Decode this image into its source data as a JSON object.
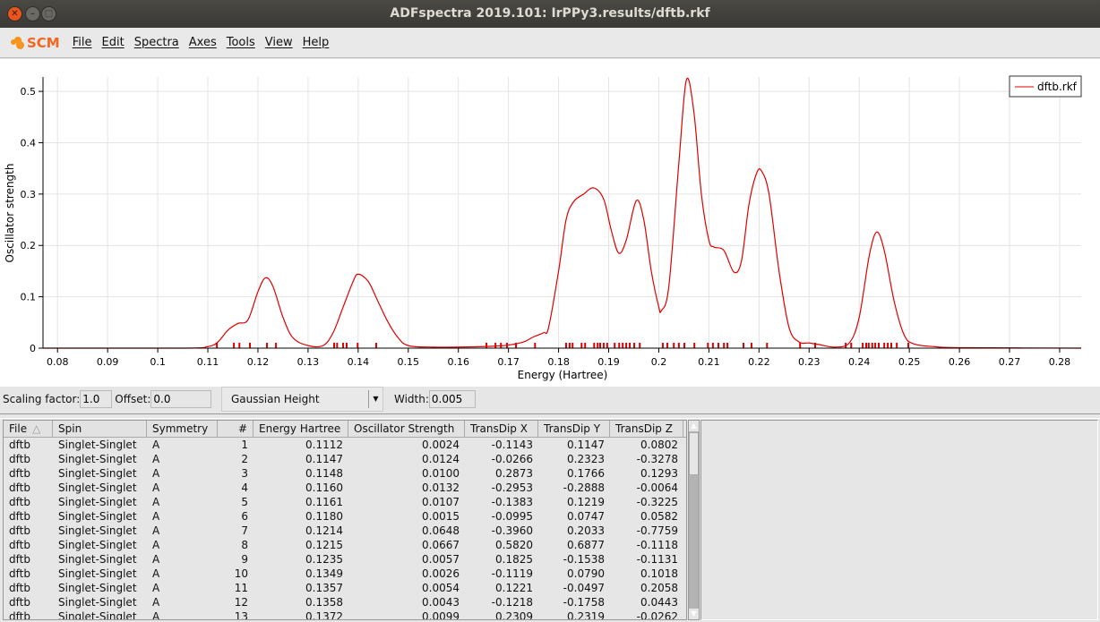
{
  "window": {
    "title": "ADFspectra 2019.101: IrPPy3.results/dftb.rkf"
  },
  "menu": {
    "logo": "SCM",
    "items": [
      "File",
      "Edit",
      "Spectra",
      "Axes",
      "Tools",
      "View",
      "Help"
    ]
  },
  "controls": {
    "scaling_label": "Scaling factor:",
    "scaling_value": "1.0",
    "offset_label": "Offset:",
    "offset_value": "0.0",
    "broadening": "Gaussian Height",
    "width_label": "Width:",
    "width_value": "0.005"
  },
  "chart_data": {
    "type": "line",
    "xlabel": "Energy (Hartree)",
    "ylabel": "Oscillator strength",
    "xlim": [
      0.0771,
      0.2843
    ],
    "ylim": [
      0,
      0.528
    ],
    "xticks": [
      0.08,
      0.09,
      0.1,
      0.11,
      0.12,
      0.13,
      0.14,
      0.15,
      0.16,
      0.17,
      0.18,
      0.19,
      0.2,
      0.21,
      0.22,
      0.23,
      0.24,
      0.25,
      0.26,
      0.27,
      0.28
    ],
    "yticks": [
      0,
      0.1,
      0.2,
      0.3,
      0.4,
      0.5
    ],
    "grid": true,
    "legend_placement": "top-right",
    "color": "#e00000",
    "series": [
      {
        "name": "dftb.rkf",
        "x": [
          0.0771,
          0.105,
          0.11,
          0.112,
          0.114,
          0.116,
          0.118,
          0.12,
          0.1215,
          0.123,
          0.125,
          0.127,
          0.13,
          0.133,
          0.135,
          0.137,
          0.139,
          0.14,
          0.142,
          0.144,
          0.146,
          0.148,
          0.15,
          0.155,
          0.165,
          0.17,
          0.173,
          0.175,
          0.177,
          0.178,
          0.18,
          0.1815,
          0.183,
          0.185,
          0.187,
          0.189,
          0.1905,
          0.192,
          0.1935,
          0.1955,
          0.197,
          0.1985,
          0.2,
          0.2005,
          0.202,
          0.204,
          0.2055,
          0.207,
          0.2085,
          0.21,
          0.211,
          0.213,
          0.215,
          0.2165,
          0.218,
          0.2195,
          0.2205,
          0.222,
          0.224,
          0.226,
          0.228,
          0.23,
          0.232,
          0.235,
          0.238,
          0.24,
          0.242,
          0.2435,
          0.245,
          0.247,
          0.249,
          0.251,
          0.255,
          0.26,
          0.2843
        ],
        "y": [
          0,
          0,
          0.003,
          0.012,
          0.035,
          0.048,
          0.055,
          0.11,
          0.137,
          0.12,
          0.06,
          0.02,
          0.005,
          0.005,
          0.03,
          0.08,
          0.13,
          0.144,
          0.13,
          0.09,
          0.05,
          0.02,
          0.005,
          0.002,
          0.003,
          0.006,
          0.012,
          0.022,
          0.03,
          0.04,
          0.15,
          0.25,
          0.285,
          0.3,
          0.312,
          0.29,
          0.23,
          0.185,
          0.21,
          0.287,
          0.25,
          0.15,
          0.08,
          0.073,
          0.12,
          0.36,
          0.522,
          0.46,
          0.3,
          0.21,
          0.197,
          0.19,
          0.148,
          0.17,
          0.28,
          0.34,
          0.345,
          0.3,
          0.15,
          0.04,
          0.012,
          0.01,
          0.007,
          0.002,
          0.01,
          0.06,
          0.18,
          0.226,
          0.19,
          0.09,
          0.025,
          0.008,
          0.003,
          0.001,
          0
        ]
      }
    ],
    "sticks": [
      0.1118,
      0.1152,
      0.1163,
      0.1184,
      0.1218,
      0.1236,
      0.1352,
      0.1358,
      0.137,
      0.1377,
      0.1399,
      0.1436,
      0.1656,
      0.1674,
      0.1685,
      0.1697,
      0.1715,
      0.1753,
      0.1815,
      0.1822,
      0.1828,
      0.1846,
      0.1853,
      0.1871,
      0.1878,
      0.1883,
      0.189,
      0.1897,
      0.1912,
      0.1921,
      0.1928,
      0.1935,
      0.1942,
      0.1951,
      0.1962,
      0.2008,
      0.2017,
      0.203,
      0.204,
      0.2051,
      0.2071,
      0.2098,
      0.2108,
      0.2119,
      0.213,
      0.2137,
      0.2169,
      0.2185,
      0.2216,
      0.2282,
      0.2312,
      0.2373,
      0.2384,
      0.2407,
      0.2414,
      0.2419,
      0.2426,
      0.2432,
      0.2439,
      0.245,
      0.2457,
      0.2464,
      0.2475,
      0.2498
    ]
  },
  "table": {
    "columns": [
      "File",
      "Spin",
      "Symmetry",
      "#",
      "Energy Hartree",
      "Oscillator Strength",
      "TransDip X",
      "TransDip Y",
      "TransDip Z"
    ],
    "sort_indicator": "△",
    "rows": [
      [
        "dftb",
        "Singlet-Singlet",
        "A",
        "1",
        "0.1112",
        "0.0024",
        "-0.1143",
        "0.1147",
        "0.0802"
      ],
      [
        "dftb",
        "Singlet-Singlet",
        "A",
        "2",
        "0.1147",
        "0.0124",
        "-0.0266",
        "0.2323",
        "-0.3278"
      ],
      [
        "dftb",
        "Singlet-Singlet",
        "A",
        "3",
        "0.1148",
        "0.0100",
        "0.2873",
        "0.1766",
        "0.1293"
      ],
      [
        "dftb",
        "Singlet-Singlet",
        "A",
        "4",
        "0.1160",
        "0.0132",
        "-0.2953",
        "-0.2888",
        "-0.0064"
      ],
      [
        "dftb",
        "Singlet-Singlet",
        "A",
        "5",
        "0.1161",
        "0.0107",
        "-0.1383",
        "0.1219",
        "-0.3225"
      ],
      [
        "dftb",
        "Singlet-Singlet",
        "A",
        "6",
        "0.1180",
        "0.0015",
        "-0.0995",
        "0.0747",
        "0.0582"
      ],
      [
        "dftb",
        "Singlet-Singlet",
        "A",
        "7",
        "0.1214",
        "0.0648",
        "-0.3960",
        "0.2033",
        "-0.7759"
      ],
      [
        "dftb",
        "Singlet-Singlet",
        "A",
        "8",
        "0.1215",
        "0.0667",
        "0.5820",
        "0.6877",
        "-0.1118"
      ],
      [
        "dftb",
        "Singlet-Singlet",
        "A",
        "9",
        "0.1235",
        "0.0057",
        "0.1825",
        "-0.1538",
        "-0.1131"
      ],
      [
        "dftb",
        "Singlet-Singlet",
        "A",
        "10",
        "0.1349",
        "0.0026",
        "-0.1119",
        "0.0790",
        "0.1018"
      ],
      [
        "dftb",
        "Singlet-Singlet",
        "A",
        "11",
        "0.1357",
        "0.0054",
        "0.1221",
        "-0.0497",
        "0.2058"
      ],
      [
        "dftb",
        "Singlet-Singlet",
        "A",
        "12",
        "0.1358",
        "0.0043",
        "-0.1218",
        "-0.1758",
        "0.0443"
      ],
      [
        "dftb",
        "Singlet-Singlet",
        "A",
        "13",
        "0.1372",
        "0.0099",
        "0.2309",
        "0.2319",
        "-0.0262"
      ]
    ]
  }
}
